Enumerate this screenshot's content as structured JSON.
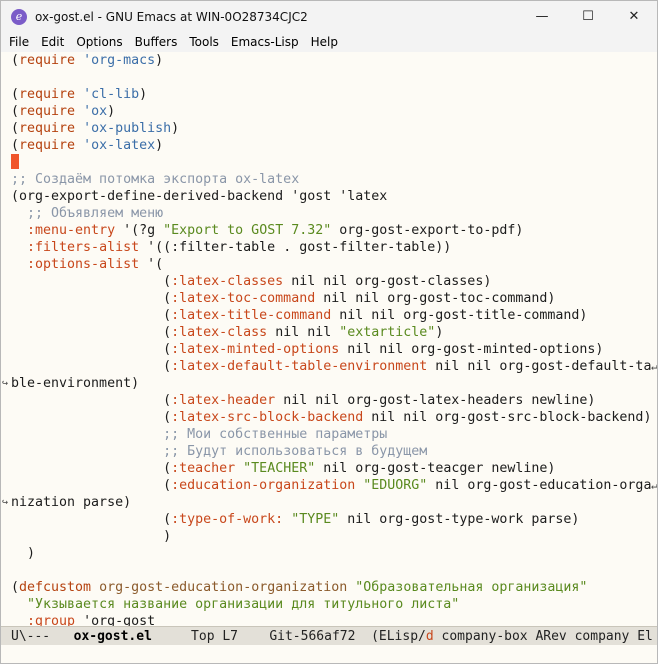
{
  "window": {
    "title": "ox-gost.el - GNU Emacs at WIN-0O28734CJC2",
    "icon": "emacs-icon",
    "controls": {
      "minimize": "—",
      "maximize": "☐",
      "close": "✕"
    }
  },
  "menu": [
    "File",
    "Edit",
    "Options",
    "Buffers",
    "Tools",
    "Emacs-Lisp",
    "Help"
  ],
  "code_lines": [
    [
      [
        "(",
        "p"
      ],
      [
        "require",
        "kw"
      ],
      [
        " ",
        ""
      ],
      [
        "'org-macs",
        "sym"
      ],
      [
        ")",
        "p"
      ]
    ],
    [],
    [
      [
        "(",
        "p"
      ],
      [
        "require",
        "kw"
      ],
      [
        " ",
        ""
      ],
      [
        "'cl-lib",
        "sym"
      ],
      [
        ")",
        "p"
      ]
    ],
    [
      [
        "(",
        "p"
      ],
      [
        "require",
        "kw"
      ],
      [
        " ",
        ""
      ],
      [
        "'ox",
        "sym"
      ],
      [
        ")",
        "p"
      ]
    ],
    [
      [
        "(",
        "p"
      ],
      [
        "require",
        "kw"
      ],
      [
        " ",
        ""
      ],
      [
        "'ox-publish",
        "sym"
      ],
      [
        ")",
        "p"
      ]
    ],
    [
      [
        "(",
        "p"
      ],
      [
        "require",
        "kw"
      ],
      [
        " ",
        ""
      ],
      [
        "'ox-latex",
        "sym"
      ],
      [
        ")",
        "p"
      ]
    ],
    "CURSOR",
    [
      [
        ";; Создаём потомка экспорта ox-latex",
        "com"
      ]
    ],
    [
      [
        "(org-export-define-derived-backend 'gost 'latex",
        "p"
      ]
    ],
    [
      [
        "  ",
        ""
      ],
      [
        ";; Объявляем меню",
        "com"
      ]
    ],
    [
      [
        "  ",
        ""
      ],
      [
        ":menu-entry",
        "key"
      ],
      [
        " '(?g ",
        "p"
      ],
      [
        "\"Export to GOST 7.32\"",
        "str"
      ],
      [
        " org-gost-export-to-pdf)",
        "p"
      ]
    ],
    [
      [
        "  ",
        ""
      ],
      [
        ":filters-alist",
        "key"
      ],
      [
        " '((:filter-table . gost-filter-table))",
        "p"
      ]
    ],
    [
      [
        "  ",
        ""
      ],
      [
        ":options-alist",
        "key"
      ],
      [
        " '(",
        "p"
      ]
    ],
    [
      [
        "                   (",
        ""
      ],
      [
        ":latex-classes",
        "key"
      ],
      [
        " nil nil org-gost-classes)",
        "p"
      ]
    ],
    [
      [
        "                   (",
        ""
      ],
      [
        ":latex-toc-command",
        "key"
      ],
      [
        " nil nil org-gost-toc-command)",
        "p"
      ]
    ],
    [
      [
        "                   (",
        ""
      ],
      [
        ":latex-title-command",
        "key"
      ],
      [
        " nil nil org-gost-title-command)",
        "p"
      ]
    ],
    [
      [
        "                   (",
        ""
      ],
      [
        ":latex-class",
        "key"
      ],
      [
        " nil nil ",
        "p"
      ],
      [
        "\"extarticle\"",
        "str"
      ],
      [
        ")",
        "p"
      ]
    ],
    [
      [
        "                   (",
        ""
      ],
      [
        ":latex-minted-options",
        "key"
      ],
      [
        " nil nil org-gost-minted-options)",
        "p"
      ]
    ],
    [
      [
        "                   (",
        ""
      ],
      [
        ":latex-default-table-environment",
        "key"
      ],
      [
        " nil nil org-gost-default-ta",
        "p"
      ]
    ],
    [
      [
        "ble-environment)",
        "p"
      ]
    ],
    [
      [
        "                   (",
        ""
      ],
      [
        ":latex-header",
        "key"
      ],
      [
        " nil nil org-gost-latex-headers newline)",
        "p"
      ]
    ],
    [
      [
        "                   (",
        ""
      ],
      [
        ":latex-src-block-backend",
        "key"
      ],
      [
        " nil nil org-gost-src-block-backend)",
        "p"
      ]
    ],
    [
      [
        "                   ",
        ""
      ],
      [
        ";; Мои собственные параметры",
        "com"
      ]
    ],
    [
      [
        "                   ",
        ""
      ],
      [
        ";; Будут использоваться в будущем",
        "com"
      ]
    ],
    [
      [
        "                   (",
        ""
      ],
      [
        ":teacher",
        "key"
      ],
      [
        " ",
        "p"
      ],
      [
        "\"TEACHER\"",
        "str"
      ],
      [
        " nil org-gost-teacger newline)",
        "p"
      ]
    ],
    [
      [
        "                   (",
        ""
      ],
      [
        ":education-organization",
        "key"
      ],
      [
        " ",
        "p"
      ],
      [
        "\"EDUORG\"",
        "str"
      ],
      [
        " nil org-gost-education-orga",
        "p"
      ]
    ],
    [
      [
        "nization parse)",
        "p"
      ]
    ],
    [
      [
        "                   (",
        ""
      ],
      [
        ":type-of-work:",
        "key"
      ],
      [
        " ",
        "p"
      ],
      [
        "\"TYPE\"",
        "str"
      ],
      [
        " nil org-gost-type-work parse)",
        "p"
      ]
    ],
    [
      [
        "                   )",
        "p"
      ]
    ],
    [
      [
        "  )",
        "p"
      ]
    ],
    [],
    [
      [
        "(",
        "p"
      ],
      [
        "defcustom",
        "kw"
      ],
      [
        " ",
        ""
      ],
      [
        "org-gost-education-organization",
        "bi"
      ],
      [
        " ",
        ""
      ],
      [
        "\"Образовательная организация\"",
        "str"
      ]
    ],
    [
      [
        "  ",
        ""
      ],
      [
        "\"Укзывается название организации для титульного листа\"",
        "str"
      ]
    ],
    [
      [
        "  ",
        ""
      ],
      [
        ":group",
        "key"
      ],
      [
        " 'org-gost",
        "p"
      ]
    ]
  ],
  "wrap_lines": [
    18,
    25
  ],
  "continuation_lines": [
    19,
    26
  ],
  "modeline": {
    "status": "U\\---",
    "buffer": "ox-gost.el",
    "position": "Top L7",
    "vc": "Git-566af72",
    "mode_prefix": "(ELisp/",
    "mode_d": "d",
    "mode_rest": " company-box ARev company El"
  },
  "colors": {
    "keyword": "#b5420f",
    "symbol": "#3b6ea8",
    "string": "#5a8a1f",
    "comment": "#8a96a8",
    "key": "#c8471b",
    "cursor": "#f0552a"
  }
}
